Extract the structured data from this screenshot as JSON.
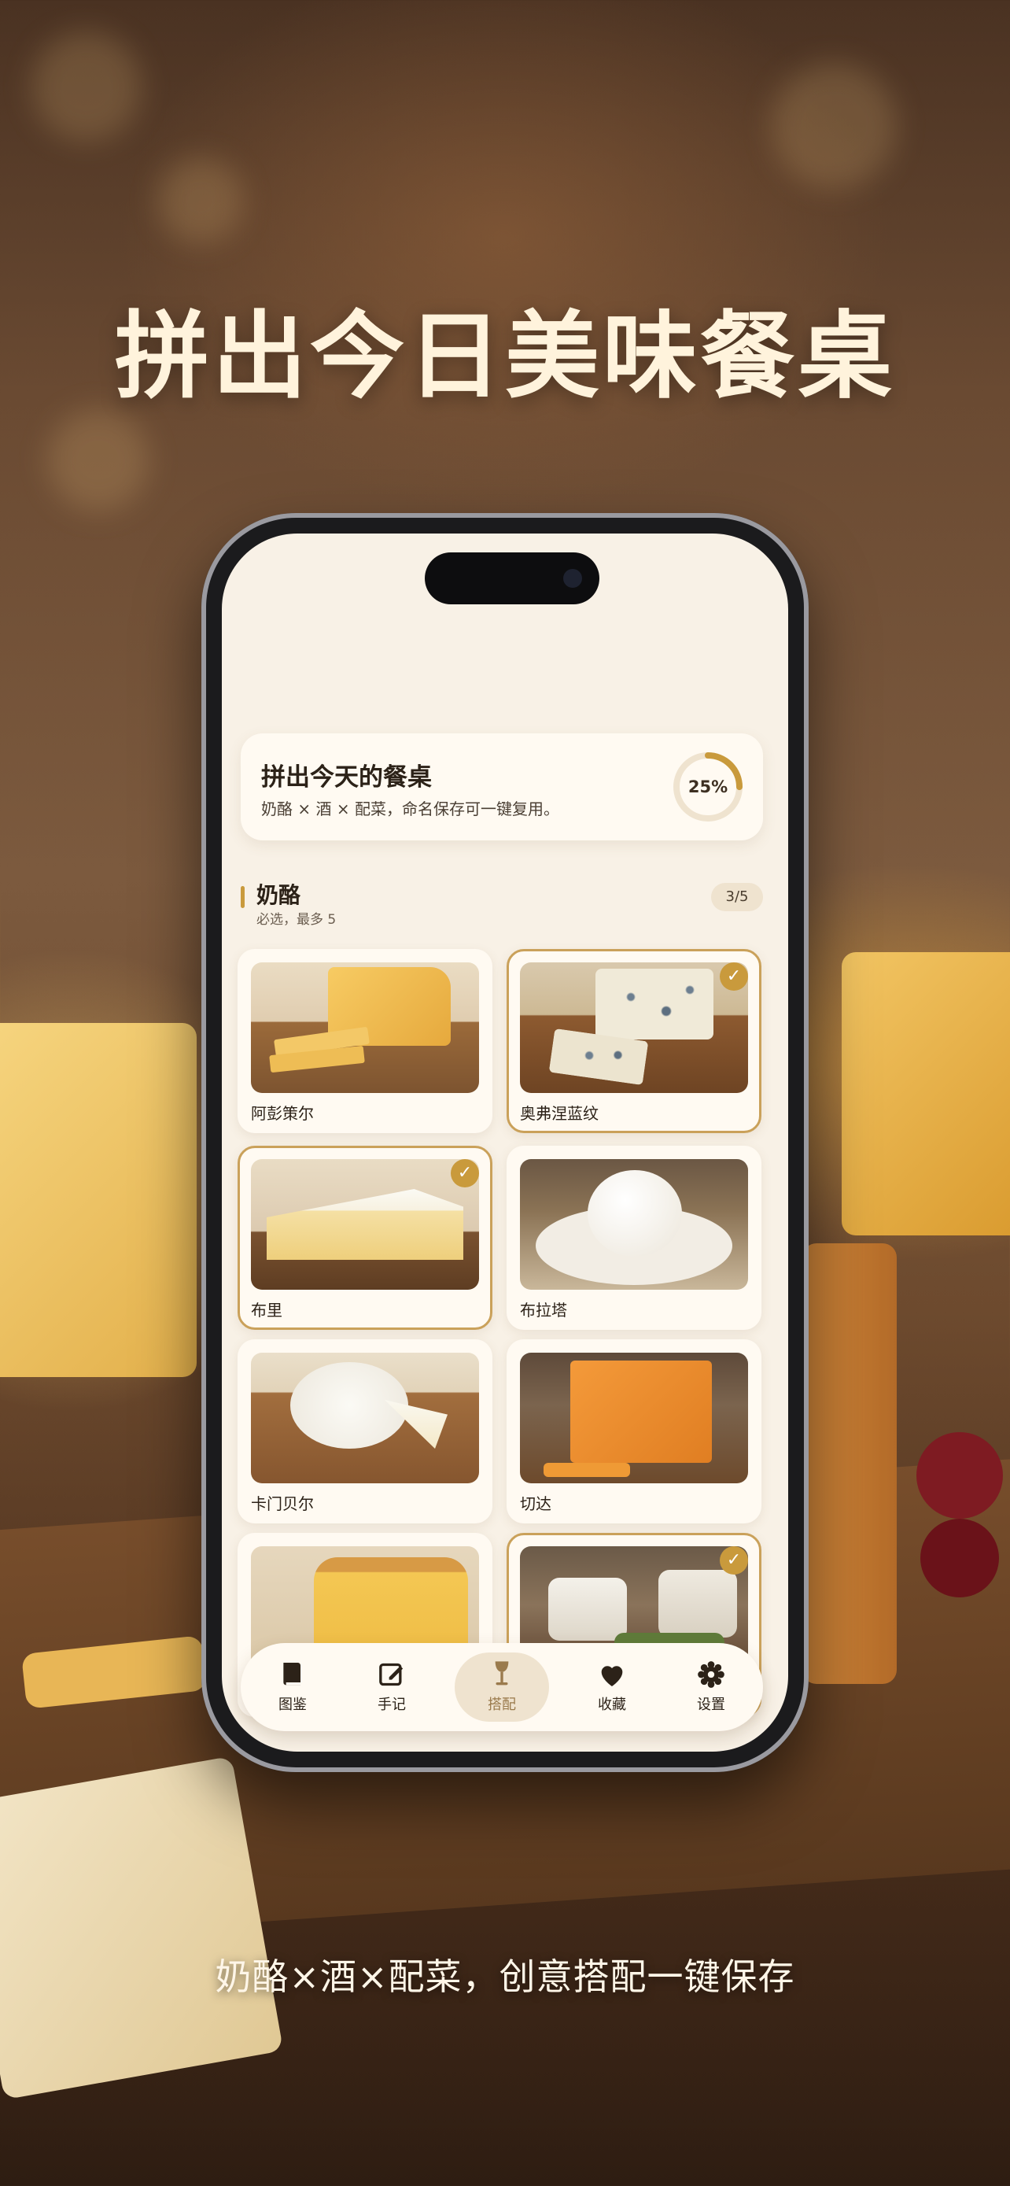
{
  "headline": "拼出今日美味餐桌",
  "subline": "奶酪×酒×配菜，创意搭配一键保存",
  "hero": {
    "title": "拼出今天的餐桌",
    "description": "奶酪 × 酒 × 配菜，命名保存可一键复用。",
    "progress_label": "25%",
    "progress_fraction": 0.25
  },
  "section": {
    "title": "奶酪",
    "hint": "必选，最多 5",
    "count": "3/5"
  },
  "cheeses": [
    {
      "name": "阿彭策尔",
      "selected": false,
      "icon": "appenzeller-cheese-photo"
    },
    {
      "name": "奥弗涅蓝纹",
      "selected": true,
      "icon": "bleu-auvergne-cheese-photo"
    },
    {
      "name": "布里",
      "selected": true,
      "icon": "brie-cheese-photo"
    },
    {
      "name": "布拉塔",
      "selected": false,
      "icon": "burrata-cheese-photo"
    },
    {
      "name": "卡门贝尔",
      "selected": false,
      "icon": "camembert-cheese-photo"
    },
    {
      "name": "切达",
      "selected": false,
      "icon": "cheddar-cheese-photo"
    },
    {
      "name": "",
      "selected": false,
      "icon": "aged-cheese-photo"
    },
    {
      "name": "",
      "selected": true,
      "icon": "goat-cheese-photo"
    }
  ],
  "tabs": [
    {
      "label": "图鉴",
      "icon": "book-icon",
      "active": false
    },
    {
      "label": "手记",
      "icon": "edit-icon",
      "active": false
    },
    {
      "label": "搭配",
      "icon": "wine-glass-icon",
      "active": true
    },
    {
      "label": "收藏",
      "icon": "heart-icon",
      "active": false
    },
    {
      "label": "设置",
      "icon": "gear-icon",
      "active": false
    }
  ],
  "colors": {
    "accent": "#c99a3c",
    "background": "#f8f1e6",
    "card": "#fffaf2"
  }
}
